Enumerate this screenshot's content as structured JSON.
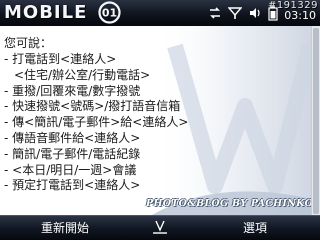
{
  "status_bar": {
    "logo_text": "MOBILE",
    "logo_badge_text": "01",
    "clock": "03:10",
    "watermark": "#191329",
    "icons": [
      "sync-icon",
      "signal-icon",
      "volume-icon",
      "battery-icon"
    ]
  },
  "content": {
    "heading": "您可說：",
    "commands": [
      {
        "text": "- 打電話到<連絡人>"
      },
      {
        "text": "<住宅/辦公室/行動電話>"
      },
      {
        "text": "- 重撥/回覆來電/數字撥號"
      },
      {
        "text": "- 快速撥號<號碼>/撥打語音信箱"
      },
      {
        "text": "- 傳<簡訊/電子郵件>給<連絡人>"
      },
      {
        "text": "- 傳語音郵件給<連絡人>"
      },
      {
        "text": "- 簡訊/電子郵件/電話紀錄"
      },
      {
        "text": "- <本日/明日/一週>會議"
      },
      {
        "text": "- 預定打電話到<連絡人>"
      }
    ],
    "photo_credit": "PHOTO&BLOG BY PACHINKO"
  },
  "softkeys": {
    "left": "重新開始",
    "right": "選項"
  },
  "colors": {
    "bar_dark": "#0f141d",
    "content_bg": "#ffffff",
    "text": "#1a1a1a"
  }
}
